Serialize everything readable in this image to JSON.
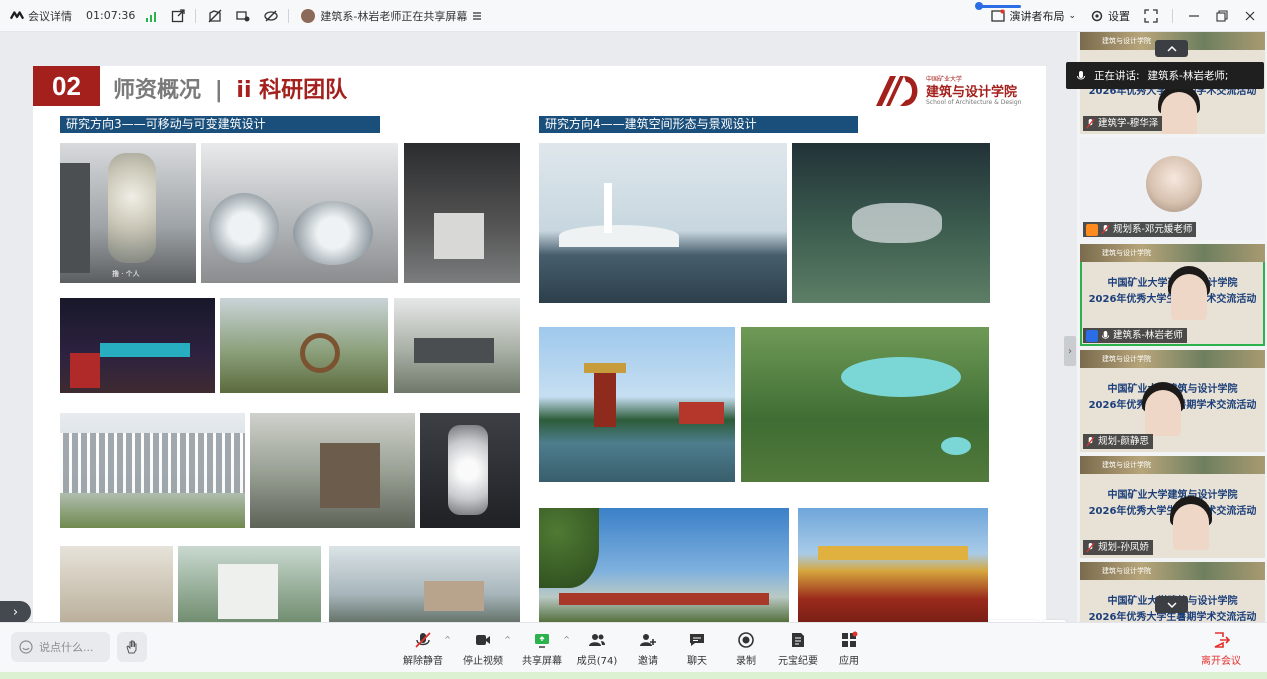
{
  "top_bar": {
    "meeting_details": "会议详情",
    "elapsed_time": "01:07:36",
    "sharing_status": "建筑系-林岩老师正在共享屏幕",
    "presenter_layout": "演讲者布局",
    "settings": "设置"
  },
  "slide": {
    "section_number": "02",
    "title": "师资概况",
    "title_divider": "|",
    "subtitle": "ii 科研团队",
    "logo_small": "中国矿业大学",
    "logo_name": "建筑与设计学院",
    "logo_english": "School of Architecture & Design",
    "direction_left": "研究方向3——可移动与可变建筑设计",
    "direction_right": "研究方向4——建筑空间形态与景观设计",
    "caption_small": "撸 · 个人"
  },
  "speaking": {
    "label": "正在讲话:",
    "speaker": "建筑系-林岩老师;"
  },
  "participants": [
    {
      "name": "建筑学-穆华泽"
    },
    {
      "name": "规划系-邓元媛老师"
    },
    {
      "name": "建筑系-林岩老师"
    },
    {
      "name": "规划-颜静思"
    },
    {
      "name": "规划-孙凤娇"
    }
  ],
  "tile_banner": {
    "school_tag": "建筑与设计学院",
    "line1": "中国矿业大学建筑与设计学院",
    "line2": "2026年优秀大学生暑期学术交流活动"
  },
  "annotate": "批注",
  "bottom_bar": {
    "chat_placeholder": "说点什么...",
    "tools": [
      {
        "label": "解除静音",
        "icon": "mic-muted-icon"
      },
      {
        "label": "停止视频",
        "icon": "camera-icon"
      },
      {
        "label": "共享屏幕",
        "icon": "share-screen-icon"
      },
      {
        "label": "成员(74)",
        "icon": "members-icon"
      },
      {
        "label": "邀请",
        "icon": "invite-icon"
      },
      {
        "label": "聊天",
        "icon": "chat-icon"
      },
      {
        "label": "录制",
        "icon": "record-icon"
      },
      {
        "label": "元宝纪要",
        "icon": "minutes-icon"
      },
      {
        "label": "应用",
        "icon": "apps-icon"
      }
    ],
    "leave": "离开会议"
  },
  "colors": {
    "accent_red": "#a3201c",
    "direction_blue": "#1b4f7b",
    "brand_blue": "#2b6de5",
    "leave_red": "#e2322d"
  }
}
